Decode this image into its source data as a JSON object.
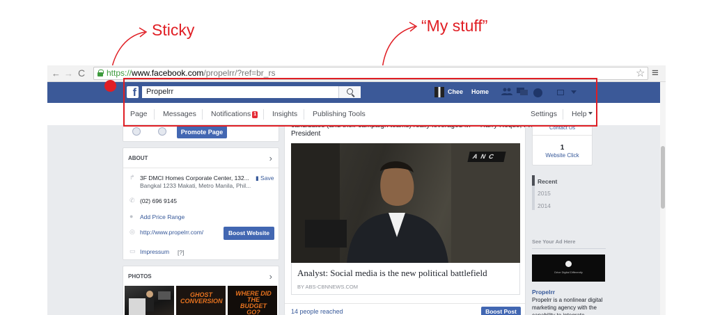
{
  "annotations": {
    "sticky": "Sticky",
    "my_stuff": "“My stuff”",
    "accent_color": "#e01e24"
  },
  "browser": {
    "back_icon": "←",
    "forward_icon": "→",
    "reload_icon": "C",
    "url_scheme": "https://",
    "url_host": "www.facebook.com",
    "url_rest": "/propelrr/?ref=br_rs",
    "star_icon": "☆",
    "menu_icon": "≡"
  },
  "fb_header": {
    "logo": "f",
    "search_value": "Propelrr",
    "user_name": "Chee",
    "home_label": "Home",
    "friends_icon": "👥",
    "messages_icon": "▬",
    "brand_color": "#3b5998"
  },
  "page_nav": {
    "page": "Page",
    "messages": "Messages",
    "notifications": "Notifications",
    "notifications_count": "1",
    "insights": "Insights",
    "publishing_tools": "Publishing Tools",
    "settings": "Settings",
    "help": "Help"
  },
  "left": {
    "promote_button": "Promote Page",
    "about": {
      "heading": "ABOUT",
      "chevron": "›",
      "address_line1": "3F DMCI Homes Corporate Center, 132...",
      "address_line2": "Bangkal 1233 Makati, Metro Manila, Phil...",
      "save": "Save",
      "phone": "(02) 696 9145",
      "price_range": "Add Price Range",
      "website": "http://www.propelrr.com/",
      "boost_website": "Boost Website",
      "impressum": "Impressum",
      "impressum_help": "[?]",
      "icons": {
        "address": "↱",
        "phone": "✆",
        "price": "●",
        "web": "◎",
        "impressum": "▭"
      }
    },
    "photos": {
      "heading": "PHOTOS",
      "chevron": "›",
      "photo2_text": "GHOST CONVERSION",
      "photo3_text": "WHERE DID THE BUDGET GO?"
    }
  },
  "post": {
    "clipped_line": "candidates (and their campaign teams) really leveraged it?” - Harry Roque, President",
    "text_tail": "President",
    "anc_logo": "ANC",
    "article_title": "Analyst: Social media is the new political battlefield",
    "article_source": "BY ABS-CBNNEWS.COM",
    "reached": "14 people reached",
    "boost_post": "Boost Post"
  },
  "right": {
    "contact_us": "Contact Us",
    "website_click_count": "1",
    "website_click_label": "Website Click",
    "timeline": [
      "Recent",
      "2015",
      "2014"
    ],
    "ad_heading": "See Your Ad Here",
    "ad_tagline": "Drive Digital Differently",
    "ad_name": "Propelrr",
    "ad_desc": "Propelrr is a nonlinear digital marketing agency with the capability to integrate"
  }
}
